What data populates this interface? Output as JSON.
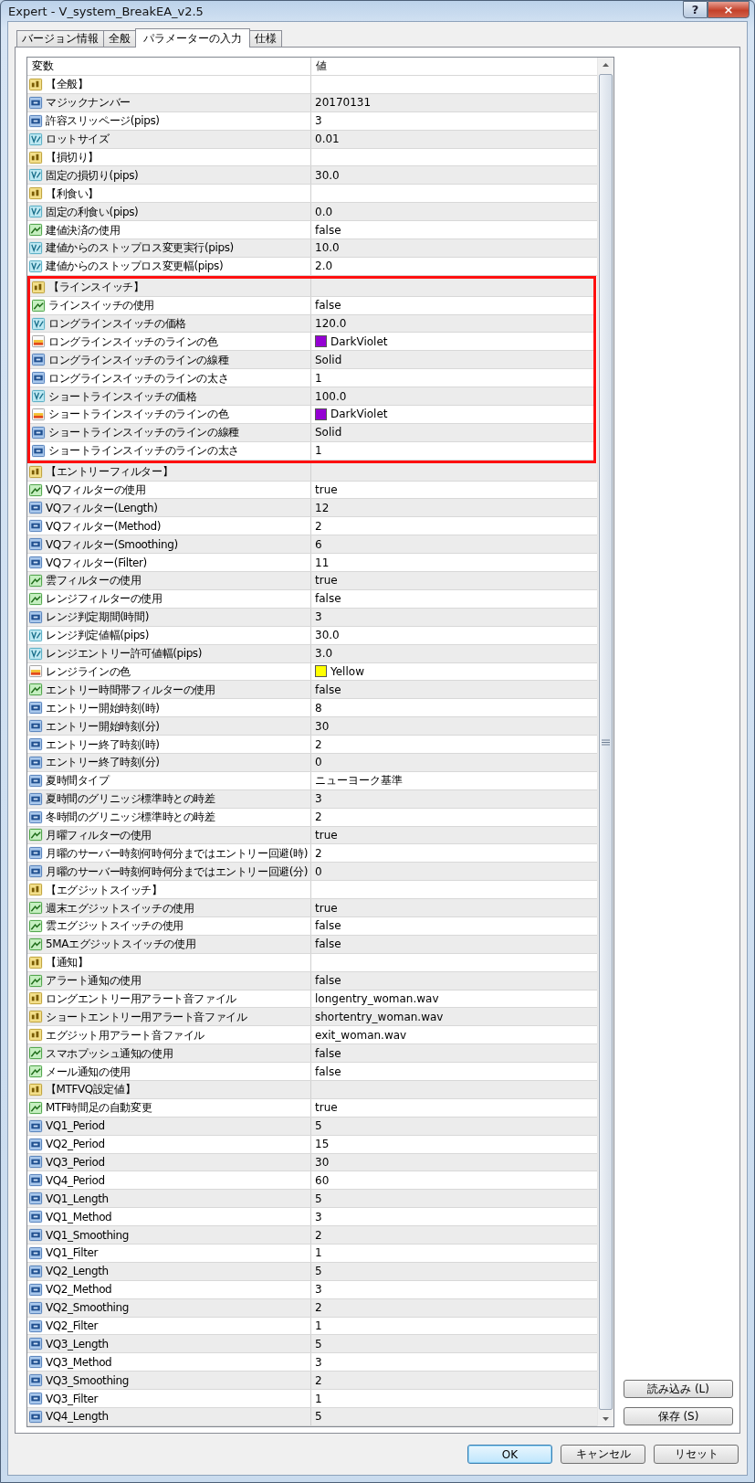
{
  "window": {
    "title": "Expert - V_system_BreakEA_v2.5",
    "help_button": "?",
    "close_button": "×"
  },
  "tabs": [
    {
      "label": "バージョン情報",
      "selected": false
    },
    {
      "label": "全般",
      "selected": false
    },
    {
      "label": "パラメーターの入力",
      "selected": true
    },
    {
      "label": "仕様",
      "selected": false
    }
  ],
  "table": {
    "columns": [
      "変数",
      "値"
    ],
    "rows": [
      {
        "kind": "string",
        "name": "【全般】",
        "value": "",
        "highlighted": false
      },
      {
        "kind": "int",
        "name": "マジックナンバー",
        "value": "20170131",
        "highlighted": false
      },
      {
        "kind": "int",
        "name": "許容スリッページ(pips)",
        "value": "3",
        "highlighted": false
      },
      {
        "kind": "double",
        "name": "ロットサイズ",
        "value": "0.01",
        "highlighted": false
      },
      {
        "kind": "string",
        "name": "【損切り】",
        "value": "",
        "highlighted": false
      },
      {
        "kind": "double",
        "name": "固定の損切り(pips)",
        "value": "30.0",
        "highlighted": false
      },
      {
        "kind": "string",
        "name": "【利食い】",
        "value": "",
        "highlighted": false
      },
      {
        "kind": "double",
        "name": "固定の利食い(pips)",
        "value": "0.0",
        "highlighted": false
      },
      {
        "kind": "bool",
        "name": "建値決済の使用",
        "value": "false",
        "highlighted": false
      },
      {
        "kind": "double",
        "name": "建値からのストップロス変更実行(pips)",
        "value": "10.0",
        "highlighted": false
      },
      {
        "kind": "double",
        "name": "建値からのストップロス変更幅(pips)",
        "value": "2.0",
        "highlighted": false
      },
      {
        "kind": "string",
        "name": "【ラインスイッチ】",
        "value": "",
        "highlighted": true
      },
      {
        "kind": "bool",
        "name": "ラインスイッチの使用",
        "value": "false",
        "highlighted": true
      },
      {
        "kind": "double",
        "name": "ロングラインスイッチの価格",
        "value": "120.0",
        "highlighted": true
      },
      {
        "kind": "color",
        "name": "ロングラインスイッチのラインの色",
        "value": "DarkViolet",
        "color": "#9400d3",
        "highlighted": true
      },
      {
        "kind": "int",
        "name": "ロングラインスイッチのラインの線種",
        "value": "Solid",
        "highlighted": true
      },
      {
        "kind": "int",
        "name": "ロングラインスイッチのラインの太さ",
        "value": "1",
        "highlighted": true
      },
      {
        "kind": "double",
        "name": "ショートラインスイッチの価格",
        "value": "100.0",
        "highlighted": true
      },
      {
        "kind": "color",
        "name": "ショートラインスイッチのラインの色",
        "value": "DarkViolet",
        "color": "#9400d3",
        "highlighted": true
      },
      {
        "kind": "int",
        "name": "ショートラインスイッチのラインの線種",
        "value": "Solid",
        "highlighted": true
      },
      {
        "kind": "int",
        "name": "ショートラインスイッチのラインの太さ",
        "value": "1",
        "highlighted": true
      },
      {
        "kind": "string",
        "name": "【エントリーフィルター】",
        "value": "",
        "highlighted": false
      },
      {
        "kind": "bool",
        "name": "VQフィルターの使用",
        "value": "true",
        "highlighted": false
      },
      {
        "kind": "int",
        "name": "VQフィルター(Length)",
        "value": "12",
        "highlighted": false
      },
      {
        "kind": "int",
        "name": "VQフィルター(Method)",
        "value": "2",
        "highlighted": false
      },
      {
        "kind": "int",
        "name": "VQフィルター(Smoothing)",
        "value": "6",
        "highlighted": false
      },
      {
        "kind": "int",
        "name": "VQフィルター(Filter)",
        "value": "11",
        "highlighted": false
      },
      {
        "kind": "bool",
        "name": "雲フィルターの使用",
        "value": "true",
        "highlighted": false
      },
      {
        "kind": "bool",
        "name": "レンジフィルターの使用",
        "value": "false",
        "highlighted": false
      },
      {
        "kind": "int",
        "name": "レンジ判定期間(時間)",
        "value": "3",
        "highlighted": false
      },
      {
        "kind": "double",
        "name": "レンジ判定値幅(pips)",
        "value": "30.0",
        "highlighted": false
      },
      {
        "kind": "double",
        "name": "レンジエントリー許可値幅(pips)",
        "value": "3.0",
        "highlighted": false
      },
      {
        "kind": "color",
        "name": "レンジラインの色",
        "value": "Yellow",
        "color": "#ffff00",
        "highlighted": false
      },
      {
        "kind": "bool",
        "name": "エントリー時間帯フィルターの使用",
        "value": "false",
        "highlighted": false
      },
      {
        "kind": "int",
        "name": "エントリー開始時刻(時)",
        "value": "8",
        "highlighted": false
      },
      {
        "kind": "int",
        "name": "エントリー開始時刻(分)",
        "value": "30",
        "highlighted": false
      },
      {
        "kind": "int",
        "name": "エントリー終了時刻(時)",
        "value": "2",
        "highlighted": false
      },
      {
        "kind": "int",
        "name": "エントリー終了時刻(分)",
        "value": "0",
        "highlighted": false
      },
      {
        "kind": "int",
        "name": "夏時間タイプ",
        "value": "ニューヨーク基準",
        "highlighted": false
      },
      {
        "kind": "int",
        "name": "夏時間のグリニッジ標準時との時差",
        "value": "3",
        "highlighted": false
      },
      {
        "kind": "int",
        "name": "冬時間のグリニッジ標準時との時差",
        "value": "2",
        "highlighted": false
      },
      {
        "kind": "bool",
        "name": "月曜フィルターの使用",
        "value": "true",
        "highlighted": false
      },
      {
        "kind": "int",
        "name": "月曜のサーバー時刻何時何分まではエントリー回避(時)",
        "value": "2",
        "highlighted": false
      },
      {
        "kind": "int",
        "name": "月曜のサーバー時刻何時何分まではエントリー回避(分)",
        "value": "0",
        "highlighted": false
      },
      {
        "kind": "string",
        "name": "【エグジットスイッチ】",
        "value": "",
        "highlighted": false
      },
      {
        "kind": "bool",
        "name": "週末エグジットスイッチの使用",
        "value": "true",
        "highlighted": false
      },
      {
        "kind": "bool",
        "name": "雲エグジットスイッチの使用",
        "value": "false",
        "highlighted": false
      },
      {
        "kind": "bool",
        "name": "5MAエグジットスイッチの使用",
        "value": "false",
        "highlighted": false
      },
      {
        "kind": "string",
        "name": "【通知】",
        "value": "",
        "highlighted": false
      },
      {
        "kind": "bool",
        "name": "アラート通知の使用",
        "value": "false",
        "highlighted": false
      },
      {
        "kind": "string",
        "name": "ロングエントリー用アラート音ファイル",
        "value": "longentry_woman.wav",
        "highlighted": false
      },
      {
        "kind": "string",
        "name": "ショートエントリー用アラート音ファイル",
        "value": "shortentry_woman.wav",
        "highlighted": false
      },
      {
        "kind": "string",
        "name": "エグジット用アラート音ファイル",
        "value": "exit_woman.wav",
        "highlighted": false
      },
      {
        "kind": "bool",
        "name": "スマホプッシュ通知の使用",
        "value": "false",
        "highlighted": false
      },
      {
        "kind": "bool",
        "name": "メール通知の使用",
        "value": "false",
        "highlighted": false
      },
      {
        "kind": "string",
        "name": "【MTFVQ設定値】",
        "value": "",
        "highlighted": false
      },
      {
        "kind": "bool",
        "name": "MTF時間足の自動変更",
        "value": "true",
        "highlighted": false
      },
      {
        "kind": "int",
        "name": "VQ1_Period",
        "value": "5",
        "highlighted": false
      },
      {
        "kind": "int",
        "name": "VQ2_Period",
        "value": "15",
        "highlighted": false
      },
      {
        "kind": "int",
        "name": "VQ3_Period",
        "value": "30",
        "highlighted": false
      },
      {
        "kind": "int",
        "name": "VQ4_Period",
        "value": "60",
        "highlighted": false
      },
      {
        "kind": "int",
        "name": "VQ1_Length",
        "value": "5",
        "highlighted": false
      },
      {
        "kind": "int",
        "name": "VQ1_Method",
        "value": "3",
        "highlighted": false
      },
      {
        "kind": "int",
        "name": "VQ1_Smoothing",
        "value": "2",
        "highlighted": false
      },
      {
        "kind": "int",
        "name": "VQ1_Filter",
        "value": "1",
        "highlighted": false
      },
      {
        "kind": "int",
        "name": "VQ2_Length",
        "value": "5",
        "highlighted": false
      },
      {
        "kind": "int",
        "name": "VQ2_Method",
        "value": "3",
        "highlighted": false
      },
      {
        "kind": "int",
        "name": "VQ2_Smoothing",
        "value": "2",
        "highlighted": false
      },
      {
        "kind": "int",
        "name": "VQ2_Filter",
        "value": "1",
        "highlighted": false
      },
      {
        "kind": "int",
        "name": "VQ3_Length",
        "value": "5",
        "highlighted": false
      },
      {
        "kind": "int",
        "name": "VQ3_Method",
        "value": "3",
        "highlighted": false
      },
      {
        "kind": "int",
        "name": "VQ3_Smoothing",
        "value": "2",
        "highlighted": false
      },
      {
        "kind": "int",
        "name": "VQ3_Filter",
        "value": "1",
        "highlighted": false
      },
      {
        "kind": "int",
        "name": "VQ4_Length",
        "value": "5",
        "highlighted": false
      }
    ]
  },
  "side_buttons": [
    "読み込み (L)",
    "保存 (S)"
  ],
  "dialog_buttons": [
    {
      "label": "OK",
      "default": true
    },
    {
      "label": "キャンセル",
      "default": false
    },
    {
      "label": "リセット",
      "default": false
    }
  ]
}
